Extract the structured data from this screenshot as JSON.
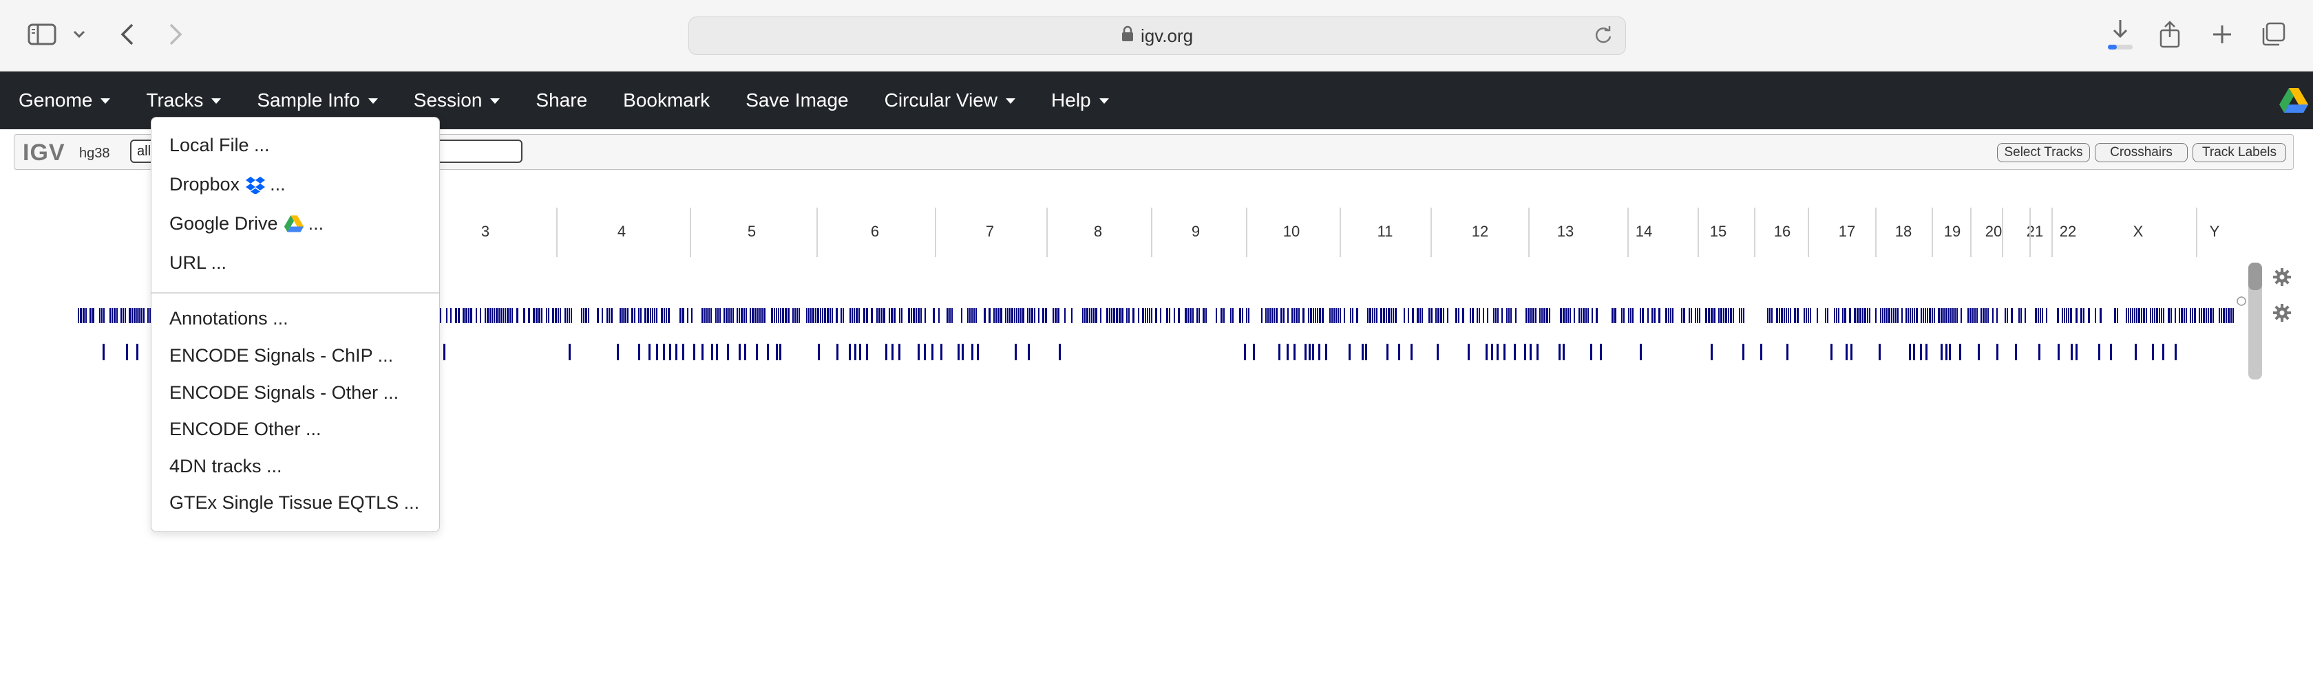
{
  "browser": {
    "url": "igv.org"
  },
  "navbar": {
    "items": [
      {
        "label": "Genome",
        "caret": true
      },
      {
        "label": "Tracks",
        "caret": true
      },
      {
        "label": "Sample Info",
        "caret": true
      },
      {
        "label": "Session",
        "caret": true
      },
      {
        "label": "Share",
        "caret": false
      },
      {
        "label": "Bookmark",
        "caret": false
      },
      {
        "label": "Save Image",
        "caret": false
      },
      {
        "label": "Circular View",
        "caret": true
      },
      {
        "label": "Help",
        "caret": true
      }
    ]
  },
  "igv_bar": {
    "logo": "IGV",
    "genome": "hg38",
    "locus_value": "all",
    "buttons": {
      "select_tracks": "Select Tracks",
      "crosshairs": "Crosshairs",
      "track_labels": "Track Labels"
    }
  },
  "chromosomes": [
    "3",
    "4",
    "5",
    "6",
    "7",
    "8",
    "9",
    "10",
    "11",
    "12",
    "13",
    "14",
    "15",
    "16",
    "17",
    "18",
    "19",
    "20",
    "21",
    "22",
    "X",
    "Y"
  ],
  "tracks_menu": {
    "items_top": [
      {
        "label": "Local File ...",
        "icon": null
      },
      {
        "label": "Dropbox",
        "suffix": "...",
        "icon": "dropbox-icon"
      },
      {
        "label": "Google Drive",
        "suffix": "...",
        "icon": "google-drive-icon"
      },
      {
        "label": "URL ...",
        "icon": null
      }
    ],
    "items_bottom": [
      "Annotations ...",
      "ENCODE Signals - ChIP ...",
      "ENCODE Signals - Other ...",
      "ENCODE Other ...",
      "4DN tracks ...",
      "GTEx Single Tissue EQTLS ..."
    ]
  },
  "colors": {
    "navbar_bg": "#222529",
    "feature": "#000080"
  }
}
